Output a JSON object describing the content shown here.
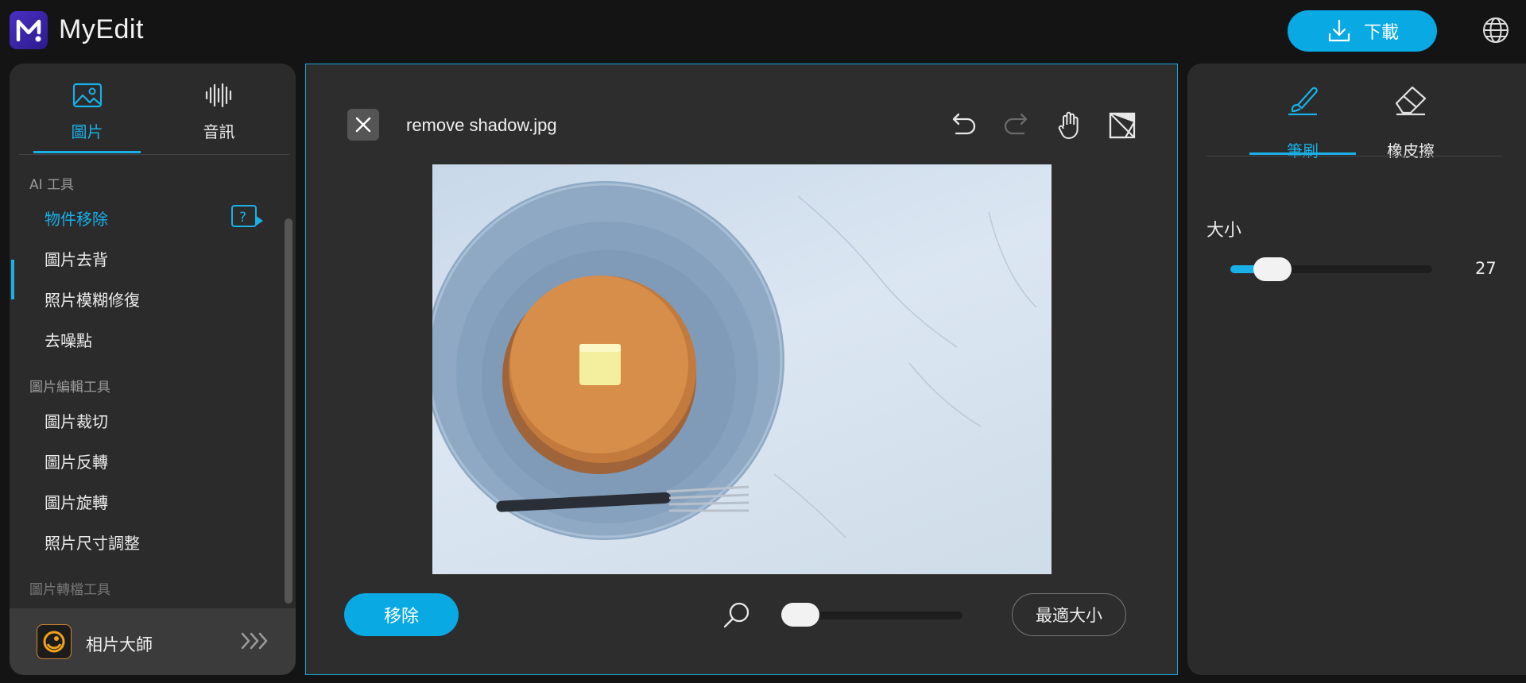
{
  "app": {
    "name": "MyEdit",
    "download_label": "下載"
  },
  "left": {
    "tabs": [
      {
        "label": "圖片",
        "icon": "image-icon"
      },
      {
        "label": "音訊",
        "icon": "audio-wave-icon"
      }
    ],
    "sections": [
      {
        "title": "AI 工具",
        "items": [
          "物件移除",
          "圖片去背",
          "照片模糊修復",
          "去噪點"
        ]
      },
      {
        "title": "圖片編輯工具",
        "items": [
          "圖片裁切",
          "圖片反轉",
          "圖片旋轉",
          "照片尺寸調整"
        ]
      },
      {
        "title": "圖片轉檔工具",
        "items": []
      }
    ],
    "active_item": "物件移除",
    "footer_label": "相片大師"
  },
  "editor": {
    "filename": "remove shadow.jpg",
    "remove_label": "移除",
    "fit_label": "最適大小",
    "zoom_level": 0
  },
  "right": {
    "tabs": [
      {
        "label": "筆刷",
        "icon": "brush-icon"
      },
      {
        "label": "橡皮擦",
        "icon": "eraser-icon"
      }
    ],
    "size_label": "大小",
    "size_value": "27",
    "size_fraction": 0.21
  },
  "colors": {
    "accent": "#09a9e4",
    "panel": "#2b2b2b",
    "background": "#141414"
  }
}
